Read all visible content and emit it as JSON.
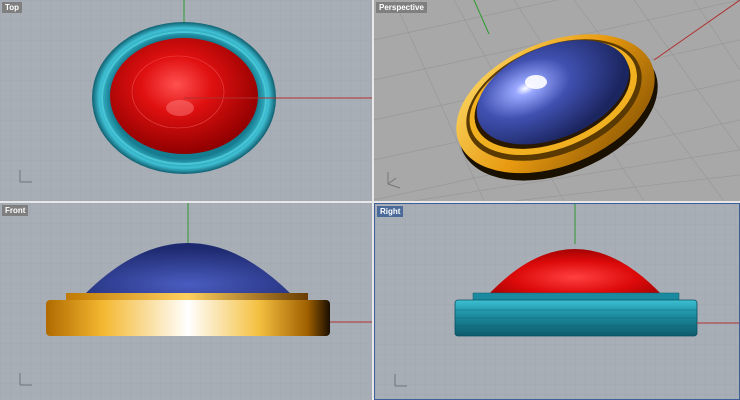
{
  "viewports": {
    "top": {
      "label": "Top"
    },
    "perspective": {
      "label": "Perspective"
    },
    "front": {
      "label": "Front"
    },
    "right": {
      "label": "Right",
      "active": true
    }
  },
  "colors": {
    "grid_bg": "#a7aeb6",
    "persp_bg": "#a8a8a8",
    "grid_line": "#9ba3ad",
    "x_axis": "#b03030",
    "y_axis": "#2f9a2f",
    "dome_red": "#d01010",
    "dome_blue": "#3c4fa0",
    "ring_teal": "#1e8fa3",
    "ring_gold": "#e8a012"
  },
  "icons": {
    "world_axes": "axes-icon"
  }
}
